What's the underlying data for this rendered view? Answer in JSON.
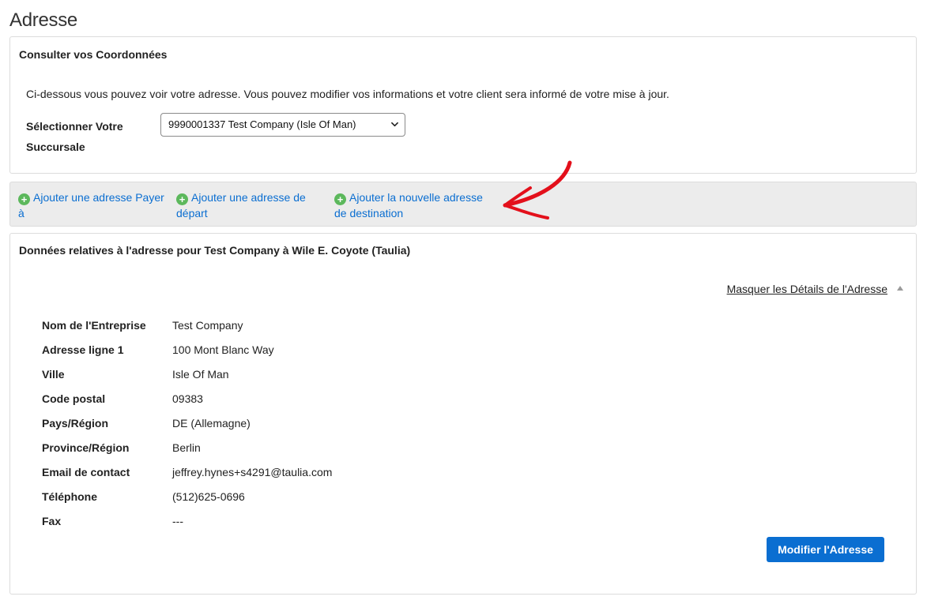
{
  "page": {
    "title": "Adresse"
  },
  "contact_panel": {
    "title": "Consulter vos Coordonnées",
    "intro": "Ci-dessous vous pouvez voir votre adresse. Vous pouvez modifier vos informations et votre client sera informé de votre mise à jour.",
    "branch_label": "Sélectionner Votre Succursale",
    "branch_selected": "9990001337 Test Company (Isle Of Man)"
  },
  "actions": [
    {
      "label": "Ajouter une adresse Payer à",
      "icon": "plus-circle-icon"
    },
    {
      "label": "Ajouter une adresse de départ",
      "icon": "plus-circle-icon"
    },
    {
      "label": "Ajouter la nouvelle adresse de destination",
      "icon": "plus-circle-icon"
    }
  ],
  "address_panel": {
    "title": "Données relatives à l'adresse pour Test Company à Wile E. Coyote (Taulia)",
    "toggle_label": "Masquer les Détails de l'Adresse",
    "fields": [
      {
        "label": "Nom de l'Entreprise",
        "value": "Test Company"
      },
      {
        "label": "Adresse ligne 1",
        "value": "100 Mont Blanc Way"
      },
      {
        "label": "Ville",
        "value": "Isle Of Man"
      },
      {
        "label": "Code postal",
        "value": "09383"
      },
      {
        "label": "Pays/Région",
        "value": "DE (Allemagne)"
      },
      {
        "label": "Province/Région",
        "value": "Berlin"
      },
      {
        "label": "Email de contact",
        "value": "jeffrey.hynes+s4291@taulia.com"
      },
      {
        "label": "Téléphone",
        "value": "(512)625-0696"
      },
      {
        "label": "Fax",
        "value": "---"
      }
    ],
    "edit_button": "Modifier l'Adresse"
  },
  "colors": {
    "link": "#0a6ed1",
    "primary_button": "#0a6ed1",
    "plus_icon": "#5cb85c",
    "annotation_arrow": "#e3101b",
    "action_bar_bg": "#ececec"
  }
}
